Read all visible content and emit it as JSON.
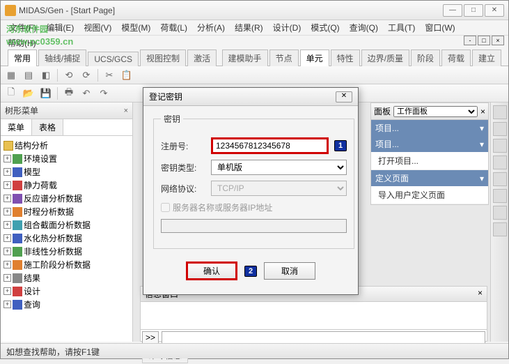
{
  "window": {
    "title": "MIDAS/Gen - [Start Page]"
  },
  "watermark": {
    "text": "河东软件园",
    "url": "www.pc0359.cn"
  },
  "menu": {
    "items": [
      "文件(F)",
      "编辑(E)",
      "视图(V)",
      "模型(M)",
      "荷载(L)",
      "分析(A)",
      "结果(R)",
      "设计(D)",
      "模式(Q)",
      "查询(Q)",
      "工具(T)",
      "窗口(W)"
    ],
    "help": "帮助(H)"
  },
  "tabs_main": [
    "常用",
    "轴线/捕捉",
    "UCS/GCS",
    "视图控制",
    "激活"
  ],
  "tabs_right": [
    "建模助手",
    "节点",
    "单元",
    "特性",
    "边界/质量",
    "阶段",
    "荷载",
    "建立"
  ],
  "tree_panel": {
    "title": "树形菜单",
    "subtabs": [
      "菜单",
      "表格"
    ],
    "root": "结构分析",
    "items": [
      {
        "label": "环境设置",
        "icon": "green"
      },
      {
        "label": "模型",
        "icon": "blue"
      },
      {
        "label": "静力荷载",
        "icon": "red"
      },
      {
        "label": "反应谱分析数据",
        "icon": "purple"
      },
      {
        "label": "时程分析数据",
        "icon": "orange"
      },
      {
        "label": "组合截面分析数据",
        "icon": "cyan"
      },
      {
        "label": "水化热分析数据",
        "icon": "blue"
      },
      {
        "label": "非线性分析数据",
        "icon": "green"
      },
      {
        "label": "施工阶段分析数据",
        "icon": "orange"
      },
      {
        "label": "结果",
        "icon": "gray"
      },
      {
        "label": "设计",
        "icon": "red"
      },
      {
        "label": "查询",
        "icon": "blue"
      }
    ]
  },
  "right_panel": {
    "title": "面板",
    "dropdown": "工作面板",
    "sections": [
      {
        "header": "项目...",
        "items": []
      },
      {
        "header": "项目...",
        "items": [
          "打开项目..."
        ]
      },
      {
        "header": "定义页面",
        "items": [
          "导入用户定义页面"
        ]
      }
    ]
  },
  "message_window": {
    "title": "信息窗口",
    "prompt": ">>",
    "tab": "命令信息"
  },
  "statusbar": {
    "text": "如想查找帮助，请按F1键"
  },
  "dialog": {
    "title": "登记密钥",
    "legend": "密钥",
    "reg_label": "注册号:",
    "reg_value": "1234567812345678",
    "type_label": "密钥类型:",
    "type_value": "单机版",
    "proto_label": "网络协议:",
    "proto_value": "TCP/IP",
    "server_chk": "服务器名称或服务器IP地址",
    "ok": "确认",
    "cancel": "取消",
    "badge1": "1",
    "badge2": "2"
  }
}
